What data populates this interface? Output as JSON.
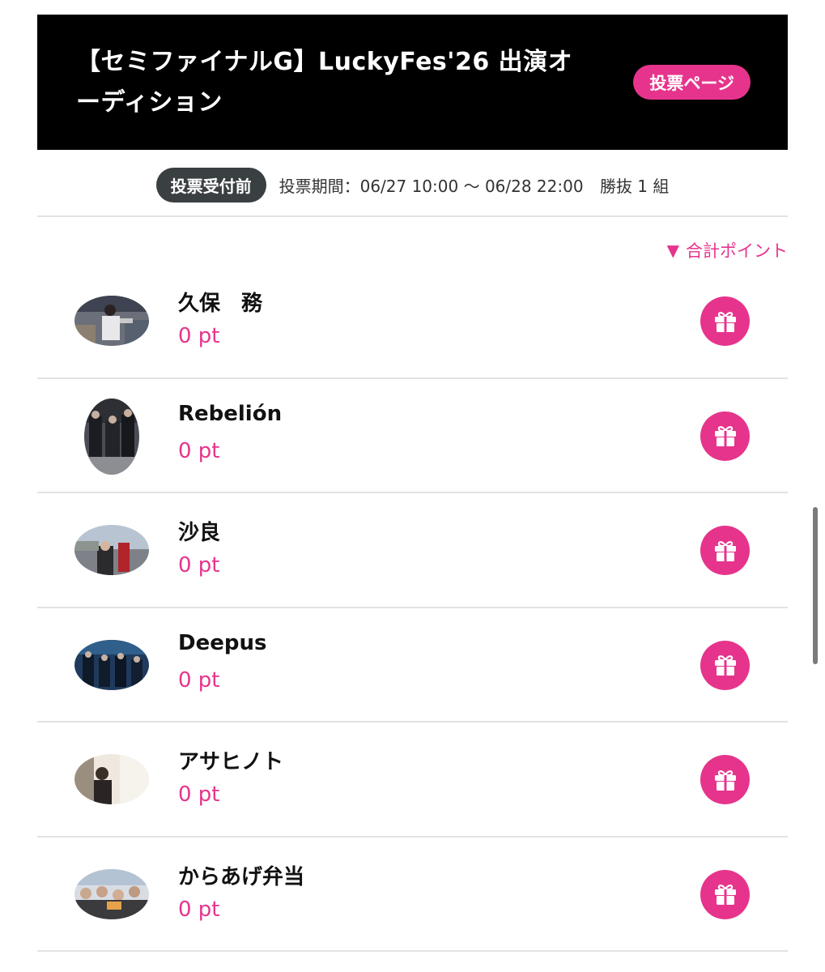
{
  "header": {
    "title": "【セミファイナルG】LuckyFes'26 出演オーディション",
    "vote_page_label": "投票ページ"
  },
  "status": {
    "badge": "投票受付前",
    "period": "投票期間：06/27 10:00 〜 06/28 22:00",
    "winners": "勝抜 1 組"
  },
  "sort": {
    "label": "合計ポイント",
    "arrow": "▼"
  },
  "entries": [
    {
      "name": "久保　務",
      "points": "0 pt"
    },
    {
      "name": "Rebelión",
      "points": "0 pt"
    },
    {
      "name": "沙良",
      "points": "0 pt"
    },
    {
      "name": "Deepus",
      "points": "0 pt"
    },
    {
      "name": "アサヒノト",
      "points": "0 pt"
    },
    {
      "name": "からあげ弁当",
      "points": "0 pt"
    }
  ],
  "colors": {
    "accent": "#e6348c",
    "banner_bg": "#000000",
    "badge_bg": "#3a3f42"
  }
}
